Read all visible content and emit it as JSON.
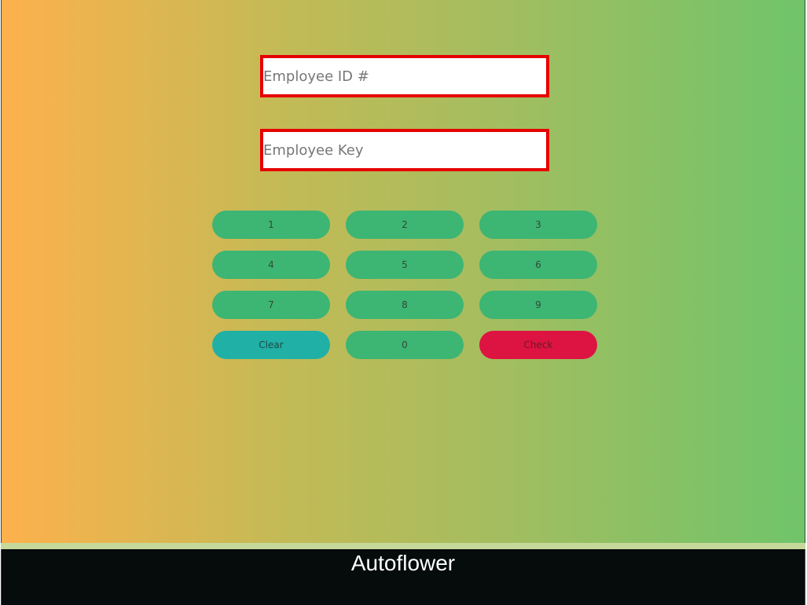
{
  "form": {
    "employee_id": {
      "value": "",
      "placeholder": "Employee ID #"
    },
    "employee_key": {
      "value": "",
      "placeholder": "Employee Key"
    }
  },
  "keypad": {
    "keys": {
      "k1": "1",
      "k2": "2",
      "k3": "3",
      "k4": "4",
      "k5": "5",
      "k6": "6",
      "k7": "7",
      "k8": "8",
      "k9": "9",
      "clear": "Clear",
      "k0": "0",
      "check": "Check"
    }
  },
  "footer": {
    "brand": "Autoflower"
  },
  "colors": {
    "gradient_start": "#fdb14c",
    "gradient_end": "#70c46a",
    "field_border": "#e60000",
    "key_green": "#3db573",
    "key_teal": "#20b0a5",
    "key_red": "#dd1341",
    "footer_bg": "#060b0c"
  }
}
